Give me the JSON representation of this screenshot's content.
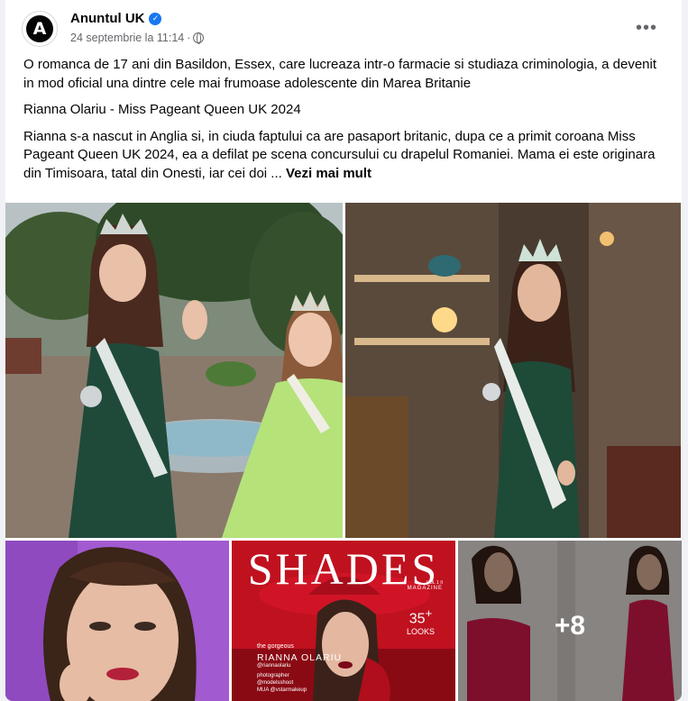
{
  "post": {
    "page_name": "Anuntul UK",
    "avatar_letter": "A",
    "verified_icon": "checkmark-icon",
    "timestamp": "24 septembrie la 11:14",
    "separator": "·",
    "audience_icon": "globe-icon",
    "more_icon": "•••",
    "paragraph_1": "O romanca de 17 ani din Basildon, Essex, care lucreaza intr-o farmacie si studiaza criminologia, a devenit in mod oficial una dintre cele mai frumoase adolescente din Marea Britanie",
    "paragraph_2": "Rianna Olariu - Miss Pageant Queen UK 2024",
    "paragraph_3": "Rianna s-a nascut in Anglia si, in ciuda faptului ca are pasaport britanic, dupa ce a primit coroana Miss Pageant Queen UK 2024, ea a defilat pe scena concursului cu drapelul Romaniei. Mama ei este originara din Timisoara, tatal din Onesti, iar cei doi ...",
    "see_more": "Vezi mai mult"
  },
  "photos": {
    "magazine": {
      "title": "SHADES",
      "subtitle": "MAGAZINE",
      "volume": "VOL 1 II",
      "looks_count": "35",
      "looks_plus": "+",
      "looks_label": "LOOKS",
      "gorgeous": "the gorgeous",
      "name": "RIANNA OLARIU",
      "handle": "@riannaolariu",
      "photographer_label": "photographer",
      "photographer": "@modelsshoot",
      "mua": "MUA @vstarmakeup"
    },
    "more_count": "+8"
  },
  "colors": {
    "brand_blue": "#1877f2",
    "magazine_red": "#c0111f",
    "sash_green": "#7bc47f",
    "dress_pink": "#d81b4d"
  }
}
